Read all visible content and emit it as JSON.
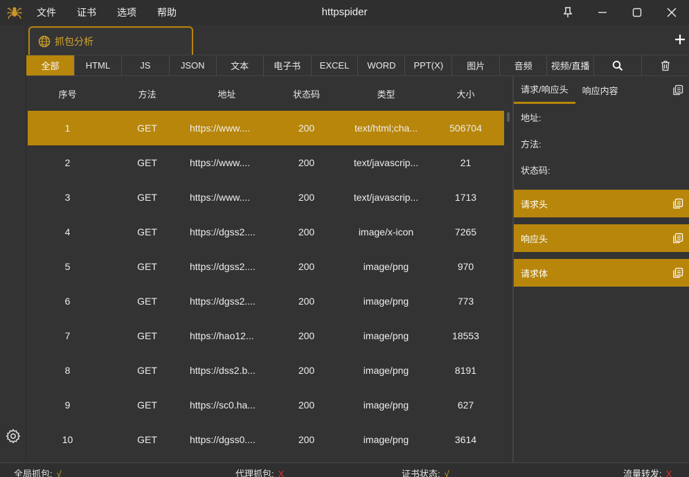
{
  "app": {
    "title": "httpspider",
    "menu": [
      "文件",
      "证书",
      "选项",
      "帮助"
    ]
  },
  "session_tab": {
    "label": "抓包分析"
  },
  "filters": {
    "tabs": [
      "全部",
      "HTML",
      "JS",
      "JSON",
      "文本",
      "电子书",
      "EXCEL",
      "WORD",
      "PPT(X)",
      "图片",
      "音频",
      "视频/直播"
    ],
    "active": "全部"
  },
  "table": {
    "headers": [
      "序号",
      "方法",
      "地址",
      "状态码",
      "类型",
      "大小"
    ],
    "rows": [
      {
        "index": "1",
        "method": "GET",
        "url": "https://www....",
        "status": "200",
        "type": "text/html;cha...",
        "size": "506704"
      },
      {
        "index": "2",
        "method": "GET",
        "url": "https://www....",
        "status": "200",
        "type": "text/javascrip...",
        "size": "21"
      },
      {
        "index": "3",
        "method": "GET",
        "url": "https://www....",
        "status": "200",
        "type": "text/javascrip...",
        "size": "1713"
      },
      {
        "index": "4",
        "method": "GET",
        "url": "https://dgss2....",
        "status": "200",
        "type": "image/x-icon",
        "size": "7265"
      },
      {
        "index": "5",
        "method": "GET",
        "url": "https://dgss2....",
        "status": "200",
        "type": "image/png",
        "size": "970"
      },
      {
        "index": "6",
        "method": "GET",
        "url": "https://dgss2....",
        "status": "200",
        "type": "image/png",
        "size": "773"
      },
      {
        "index": "7",
        "method": "GET",
        "url": "https://hao12...",
        "status": "200",
        "type": "image/png",
        "size": "18553"
      },
      {
        "index": "8",
        "method": "GET",
        "url": "https://dss2.b...",
        "status": "200",
        "type": "image/png",
        "size": "8191"
      },
      {
        "index": "9",
        "method": "GET",
        "url": "https://sc0.ha...",
        "status": "200",
        "type": "image/png",
        "size": "627"
      },
      {
        "index": "10",
        "method": "GET",
        "url": "https://dgss0....",
        "status": "200",
        "type": "image/png",
        "size": "3614"
      }
    ],
    "selected_index": "1"
  },
  "detail": {
    "tabs": [
      "请求/响应头",
      "响应内容"
    ],
    "active_tab": "请求/响应头",
    "fields": [
      "地址:",
      "方法:",
      "状态码:"
    ],
    "sections": [
      "请求头",
      "响应头",
      "请求体"
    ]
  },
  "status": {
    "global_capture": "全局抓包:",
    "global_capture_value": "√",
    "proxy_capture": "代理抓包:",
    "proxy_capture_value": "X",
    "cert_status": "证书状态:",
    "cert_status_value": "√",
    "traffic_forward": "流量转发:",
    "traffic_forward_value": "X"
  },
  "colors": {
    "accent": "#b8860b",
    "background": "#333333",
    "ok": "#d4a52a",
    "error": "#e03030"
  },
  "icons": {
    "app": "spider-icon",
    "pin": "pin-icon",
    "minimize": "minimize-icon",
    "maximize": "maximize-icon",
    "close": "close-icon",
    "session": "globe-icon",
    "add": "plus-icon",
    "search": "search-icon",
    "clear": "trash-icon",
    "copy": "copy-icon",
    "settings": "gear-icon"
  }
}
